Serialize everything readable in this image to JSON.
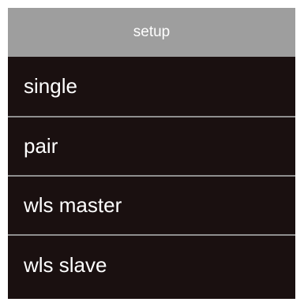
{
  "header": {
    "title": "setup"
  },
  "menu": {
    "items": [
      {
        "label": "single"
      },
      {
        "label": "pair"
      },
      {
        "label": "wls master"
      },
      {
        "label": "wls slave"
      }
    ]
  },
  "colors": {
    "header_bg": "#9e9e9e",
    "item_bg": "#1a1010",
    "divider": "#8f8f8f",
    "text": "#ffffff"
  }
}
